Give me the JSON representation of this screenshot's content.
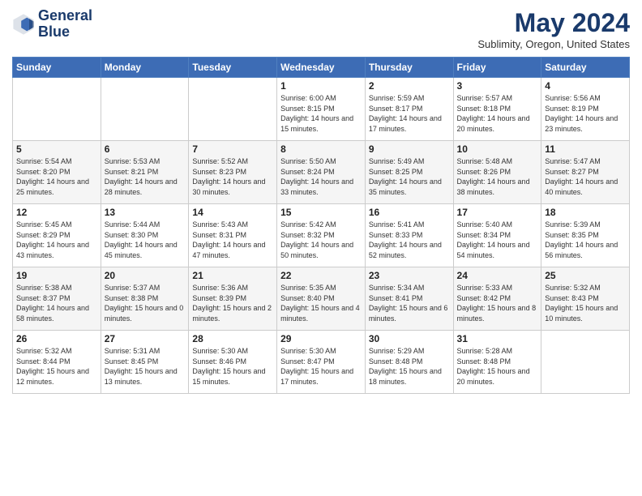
{
  "logo": {
    "line1": "General",
    "line2": "Blue"
  },
  "title": "May 2024",
  "subtitle": "Sublimity, Oregon, United States",
  "weekdays": [
    "Sunday",
    "Monday",
    "Tuesday",
    "Wednesday",
    "Thursday",
    "Friday",
    "Saturday"
  ],
  "weeks": [
    [
      {
        "day": "",
        "sunrise": "",
        "sunset": "",
        "daylight": ""
      },
      {
        "day": "",
        "sunrise": "",
        "sunset": "",
        "daylight": ""
      },
      {
        "day": "",
        "sunrise": "",
        "sunset": "",
        "daylight": ""
      },
      {
        "day": "1",
        "sunrise": "Sunrise: 6:00 AM",
        "sunset": "Sunset: 8:15 PM",
        "daylight": "Daylight: 14 hours and 15 minutes."
      },
      {
        "day": "2",
        "sunrise": "Sunrise: 5:59 AM",
        "sunset": "Sunset: 8:17 PM",
        "daylight": "Daylight: 14 hours and 17 minutes."
      },
      {
        "day": "3",
        "sunrise": "Sunrise: 5:57 AM",
        "sunset": "Sunset: 8:18 PM",
        "daylight": "Daylight: 14 hours and 20 minutes."
      },
      {
        "day": "4",
        "sunrise": "Sunrise: 5:56 AM",
        "sunset": "Sunset: 8:19 PM",
        "daylight": "Daylight: 14 hours and 23 minutes."
      }
    ],
    [
      {
        "day": "5",
        "sunrise": "Sunrise: 5:54 AM",
        "sunset": "Sunset: 8:20 PM",
        "daylight": "Daylight: 14 hours and 25 minutes."
      },
      {
        "day": "6",
        "sunrise": "Sunrise: 5:53 AM",
        "sunset": "Sunset: 8:21 PM",
        "daylight": "Daylight: 14 hours and 28 minutes."
      },
      {
        "day": "7",
        "sunrise": "Sunrise: 5:52 AM",
        "sunset": "Sunset: 8:23 PM",
        "daylight": "Daylight: 14 hours and 30 minutes."
      },
      {
        "day": "8",
        "sunrise": "Sunrise: 5:50 AM",
        "sunset": "Sunset: 8:24 PM",
        "daylight": "Daylight: 14 hours and 33 minutes."
      },
      {
        "day": "9",
        "sunrise": "Sunrise: 5:49 AM",
        "sunset": "Sunset: 8:25 PM",
        "daylight": "Daylight: 14 hours and 35 minutes."
      },
      {
        "day": "10",
        "sunrise": "Sunrise: 5:48 AM",
        "sunset": "Sunset: 8:26 PM",
        "daylight": "Daylight: 14 hours and 38 minutes."
      },
      {
        "day": "11",
        "sunrise": "Sunrise: 5:47 AM",
        "sunset": "Sunset: 8:27 PM",
        "daylight": "Daylight: 14 hours and 40 minutes."
      }
    ],
    [
      {
        "day": "12",
        "sunrise": "Sunrise: 5:45 AM",
        "sunset": "Sunset: 8:29 PM",
        "daylight": "Daylight: 14 hours and 43 minutes."
      },
      {
        "day": "13",
        "sunrise": "Sunrise: 5:44 AM",
        "sunset": "Sunset: 8:30 PM",
        "daylight": "Daylight: 14 hours and 45 minutes."
      },
      {
        "day": "14",
        "sunrise": "Sunrise: 5:43 AM",
        "sunset": "Sunset: 8:31 PM",
        "daylight": "Daylight: 14 hours and 47 minutes."
      },
      {
        "day": "15",
        "sunrise": "Sunrise: 5:42 AM",
        "sunset": "Sunset: 8:32 PM",
        "daylight": "Daylight: 14 hours and 50 minutes."
      },
      {
        "day": "16",
        "sunrise": "Sunrise: 5:41 AM",
        "sunset": "Sunset: 8:33 PM",
        "daylight": "Daylight: 14 hours and 52 minutes."
      },
      {
        "day": "17",
        "sunrise": "Sunrise: 5:40 AM",
        "sunset": "Sunset: 8:34 PM",
        "daylight": "Daylight: 14 hours and 54 minutes."
      },
      {
        "day": "18",
        "sunrise": "Sunrise: 5:39 AM",
        "sunset": "Sunset: 8:35 PM",
        "daylight": "Daylight: 14 hours and 56 minutes."
      }
    ],
    [
      {
        "day": "19",
        "sunrise": "Sunrise: 5:38 AM",
        "sunset": "Sunset: 8:37 PM",
        "daylight": "Daylight: 14 hours and 58 minutes."
      },
      {
        "day": "20",
        "sunrise": "Sunrise: 5:37 AM",
        "sunset": "Sunset: 8:38 PM",
        "daylight": "Daylight: 15 hours and 0 minutes."
      },
      {
        "day": "21",
        "sunrise": "Sunrise: 5:36 AM",
        "sunset": "Sunset: 8:39 PM",
        "daylight": "Daylight: 15 hours and 2 minutes."
      },
      {
        "day": "22",
        "sunrise": "Sunrise: 5:35 AM",
        "sunset": "Sunset: 8:40 PM",
        "daylight": "Daylight: 15 hours and 4 minutes."
      },
      {
        "day": "23",
        "sunrise": "Sunrise: 5:34 AM",
        "sunset": "Sunset: 8:41 PM",
        "daylight": "Daylight: 15 hours and 6 minutes."
      },
      {
        "day": "24",
        "sunrise": "Sunrise: 5:33 AM",
        "sunset": "Sunset: 8:42 PM",
        "daylight": "Daylight: 15 hours and 8 minutes."
      },
      {
        "day": "25",
        "sunrise": "Sunrise: 5:32 AM",
        "sunset": "Sunset: 8:43 PM",
        "daylight": "Daylight: 15 hours and 10 minutes."
      }
    ],
    [
      {
        "day": "26",
        "sunrise": "Sunrise: 5:32 AM",
        "sunset": "Sunset: 8:44 PM",
        "daylight": "Daylight: 15 hours and 12 minutes."
      },
      {
        "day": "27",
        "sunrise": "Sunrise: 5:31 AM",
        "sunset": "Sunset: 8:45 PM",
        "daylight": "Daylight: 15 hours and 13 minutes."
      },
      {
        "day": "28",
        "sunrise": "Sunrise: 5:30 AM",
        "sunset": "Sunset: 8:46 PM",
        "daylight": "Daylight: 15 hours and 15 minutes."
      },
      {
        "day": "29",
        "sunrise": "Sunrise: 5:30 AM",
        "sunset": "Sunset: 8:47 PM",
        "daylight": "Daylight: 15 hours and 17 minutes."
      },
      {
        "day": "30",
        "sunrise": "Sunrise: 5:29 AM",
        "sunset": "Sunset: 8:48 PM",
        "daylight": "Daylight: 15 hours and 18 minutes."
      },
      {
        "day": "31",
        "sunrise": "Sunrise: 5:28 AM",
        "sunset": "Sunset: 8:48 PM",
        "daylight": "Daylight: 15 hours and 20 minutes."
      },
      {
        "day": "",
        "sunrise": "",
        "sunset": "",
        "daylight": ""
      }
    ]
  ]
}
